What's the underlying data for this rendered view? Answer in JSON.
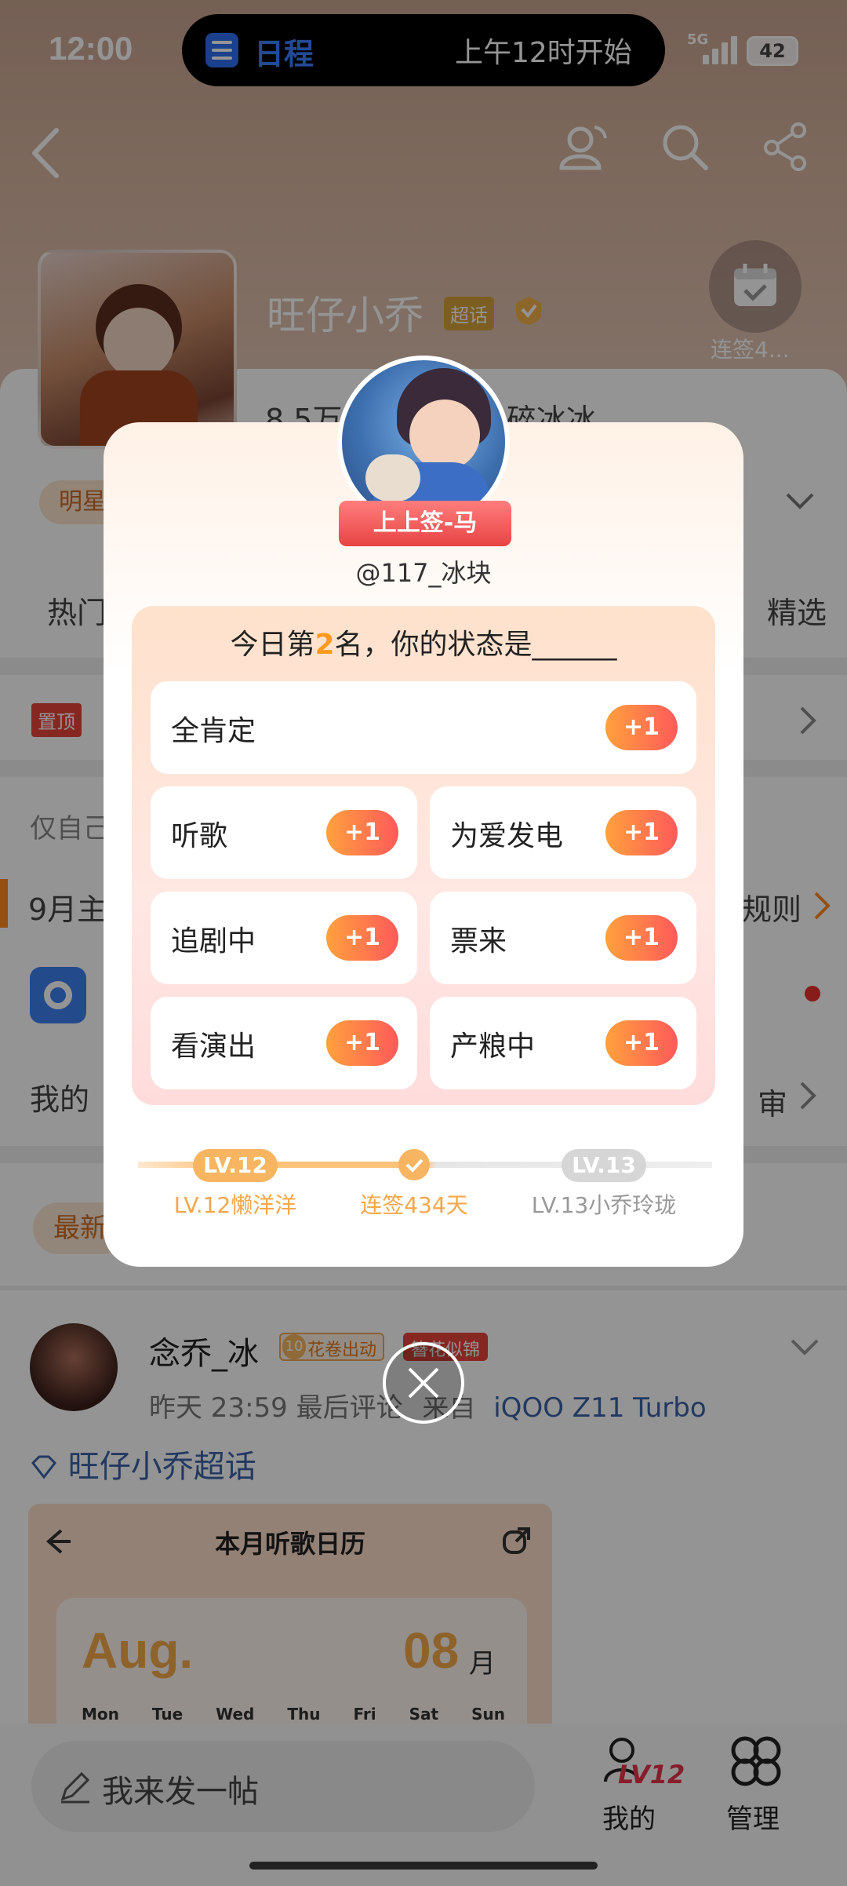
{
  "status_bar": {
    "time": "12:00",
    "island_app": "日程",
    "island_text": "上午12时开始",
    "network": "5G",
    "battery": "42"
  },
  "profile": {
    "name": "旺仔小乔",
    "tag": "超话",
    "followers": "8.5万",
    "host_name": "碎冰冰",
    "checkin_label": "连签4...",
    "badge_left": "明星",
    "tabs": [
      "热门",
      "精选"
    ],
    "pinned_tag": "置顶",
    "row_only_me": "仅自己",
    "row_month": "9月主",
    "row_rules": "规则",
    "row_mine": "我的",
    "row_review": "审",
    "row_latest": "最新"
  },
  "post": {
    "author": "念乔_冰",
    "author_badge_level": "10",
    "author_badge": "花卷出动",
    "author_badge2": "簪花似锦",
    "meta": "昨天 23:59 最后评论",
    "source_prefix": "来自",
    "source": "iQOO Z11 Turbo",
    "topic": "旺仔小乔超话",
    "calendar_title": "本月听歌日历",
    "calendar_month": "Aug.",
    "calendar_num": "08",
    "calendar_unit": "月",
    "weekdays": [
      "Mon",
      "Tue",
      "Wed",
      "Thu",
      "Fri",
      "Sat",
      "Sun"
    ]
  },
  "bottom": {
    "compose_placeholder": "我来发一帖",
    "my_level": "LV12",
    "my_label": "我的",
    "manage_label": "管理"
  },
  "modal": {
    "title_ribbon": "上上签-马",
    "username": "@117_冰块",
    "prompt_prefix": "今日第",
    "rank": "2",
    "prompt_suffix": "名，你的状态是______",
    "options": [
      {
        "label": "全肯定",
        "plus": "+1"
      },
      {
        "label": "听歌",
        "plus": "+1"
      },
      {
        "label": "为爱发电",
        "plus": "+1"
      },
      {
        "label": "追剧中",
        "plus": "+1"
      },
      {
        "label": "票来",
        "plus": "+1"
      },
      {
        "label": "看演出",
        "plus": "+1"
      },
      {
        "label": "产粮中",
        "plus": "+1"
      }
    ],
    "level_current_badge": "LV.12",
    "level_current": "LV.12懒洋洋",
    "streak": "连签434天",
    "level_next_badge": "LV.13",
    "level_next": "LV.13小乔玲珑"
  },
  "colors": {
    "accent": "#ff8a3d",
    "rank": "#ff9a1f",
    "level": "#f5a74a"
  }
}
